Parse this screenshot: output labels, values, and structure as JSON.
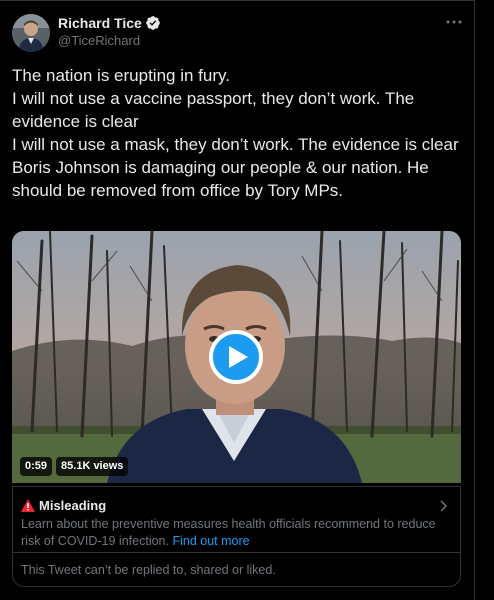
{
  "author": {
    "name": "Richard Tice",
    "handle": "@TiceRichard",
    "verified": true
  },
  "tweet_lines": [
    "The nation is erupting in fury.",
    "I will not use a vaccine passport, they don’t work. The evidence is clear",
    "I will not use a mask, they don’t work. The evidence is clear",
    "Boris Johnson is damaging our people & our nation. He should be removed from office by Tory MPs."
  ],
  "video": {
    "duration": "0:59",
    "views": "85.1K views"
  },
  "misleading": {
    "title": "Misleading",
    "text": "Learn about the preventive measures health officials recommend to reduce risk of COVID-19 infection.",
    "link": "Find out more",
    "notice": "This Tweet can’t be replied to, shared or liked."
  },
  "colors": {
    "background": "#000000",
    "text": "#e7e9ea",
    "muted": "#71767b",
    "accent": "#1d9bf0",
    "warning": "#f4212e",
    "border": "#2f3336"
  },
  "icons": [
    "verified-badge-icon",
    "more-icon",
    "play-icon",
    "warning-icon",
    "chevron-right-icon"
  ]
}
